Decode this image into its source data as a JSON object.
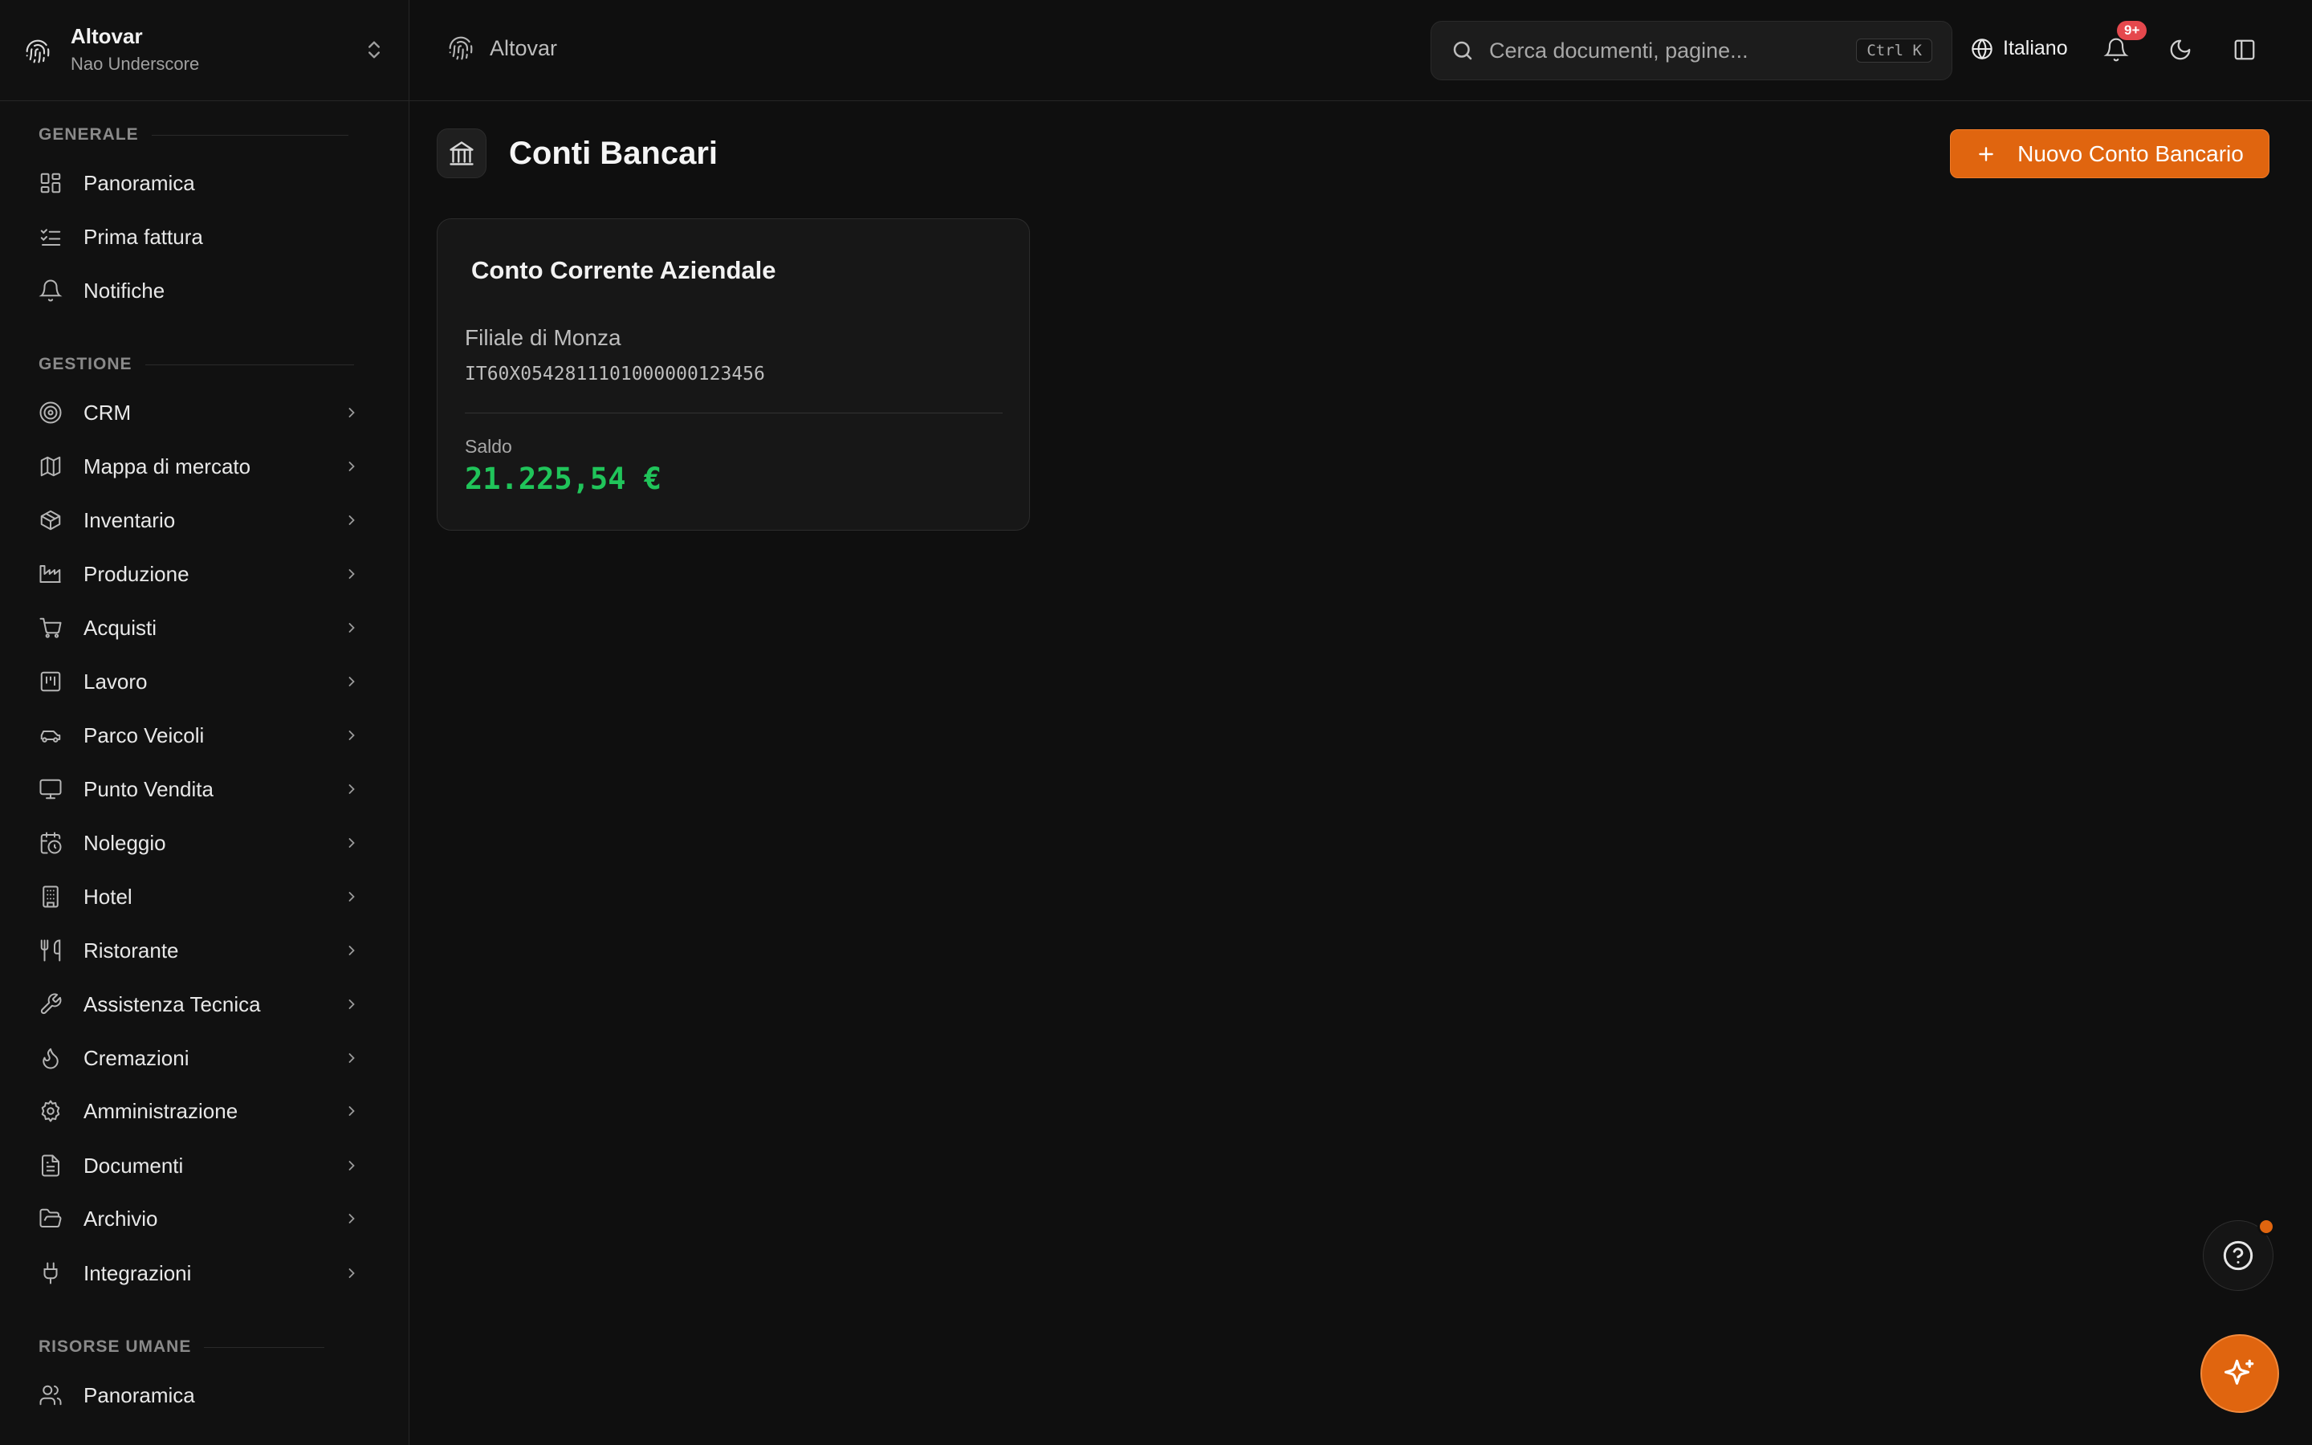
{
  "org": {
    "name": "Altovar",
    "subtitle": "Nao Underscore"
  },
  "sidebar": {
    "sections": [
      {
        "title": "GENERALE",
        "items": [
          {
            "label": "Panoramica",
            "icon": "dashboard-icon"
          },
          {
            "label": "Prima fattura",
            "icon": "list-check-icon"
          },
          {
            "label": "Notifiche",
            "icon": "bell-icon"
          }
        ]
      },
      {
        "title": "GESTIONE",
        "items": [
          {
            "label": "CRM",
            "icon": "target-icon"
          },
          {
            "label": "Mappa di mercato",
            "icon": "map-icon"
          },
          {
            "label": "Inventario",
            "icon": "package-icon"
          },
          {
            "label": "Produzione",
            "icon": "factory-icon"
          },
          {
            "label": "Acquisti",
            "icon": "cart-icon"
          },
          {
            "label": "Lavoro",
            "icon": "kanban-icon"
          },
          {
            "label": "Parco Veicoli",
            "icon": "car-icon"
          },
          {
            "label": "Punto Vendita",
            "icon": "monitor-icon"
          },
          {
            "label": "Noleggio",
            "icon": "calendar-clock-icon"
          },
          {
            "label": "Hotel",
            "icon": "building-icon"
          },
          {
            "label": "Ristorante",
            "icon": "utensils-icon"
          },
          {
            "label": "Assistenza Tecnica",
            "icon": "wrench-icon"
          },
          {
            "label": "Cremazioni",
            "icon": "flame-icon"
          },
          {
            "label": "Amministrazione",
            "icon": "gear-icon"
          },
          {
            "label": "Documenti",
            "icon": "file-text-icon"
          },
          {
            "label": "Archivio",
            "icon": "folder-open-icon"
          },
          {
            "label": "Integrazioni",
            "icon": "plug-icon"
          }
        ]
      },
      {
        "title": "RISORSE UMANE",
        "items": [
          {
            "label": "Panoramica",
            "icon": "users-icon"
          }
        ]
      }
    ]
  },
  "topbar": {
    "breadcrumb": "Altovar",
    "search_placeholder": "Cerca documenti, pagine...",
    "search_shortcut": "Ctrl K",
    "language": "Italiano",
    "notifications_badge": "9+"
  },
  "page": {
    "title": "Conti Bancari",
    "new_button_label": "Nuovo Conto Bancario"
  },
  "accounts": [
    {
      "name": "Conto Corrente Aziendale",
      "branch": "Filiale di Monza",
      "iban": "IT60X0542811101000000123456",
      "balance_label": "Saldo",
      "balance": "21.225,54 €"
    }
  ],
  "colors": {
    "accent": "#e0650f",
    "positive": "#20c45a",
    "badge": "#e5484d"
  }
}
